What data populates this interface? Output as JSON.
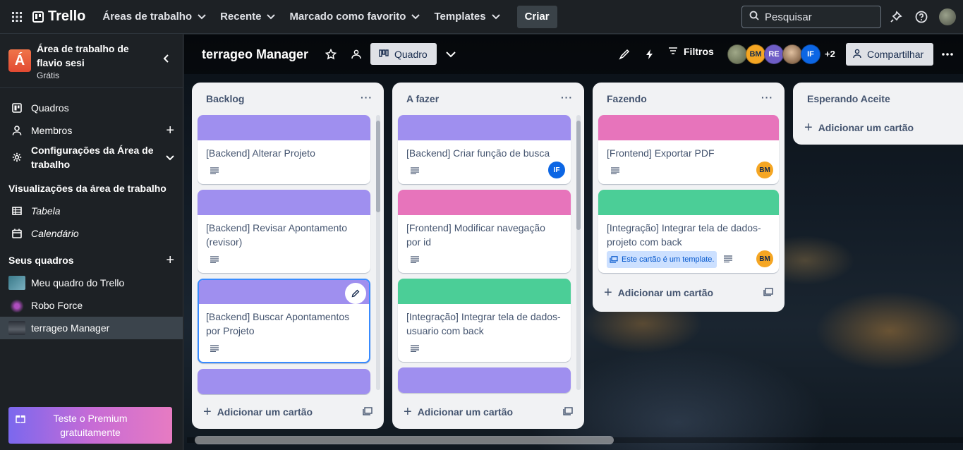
{
  "topbar": {
    "app_name": "Trello",
    "nav": [
      {
        "label": "Áreas de trabalho"
      },
      {
        "label": "Recente"
      },
      {
        "label": "Marcado como favorito"
      },
      {
        "label": "Templates"
      }
    ],
    "create_label": "Criar",
    "search_placeholder": "Pesquisar"
  },
  "sidebar": {
    "workspace_initial": "Á",
    "workspace_name_line1": "Área de trabalho de",
    "workspace_name_line2": "flavio sesi",
    "workspace_plan": "Grátis",
    "items": [
      {
        "label": "Quadros",
        "icon": "board-icon"
      },
      {
        "label": "Membros",
        "icon": "person-icon"
      },
      {
        "label_line1": "Configurações da Área de",
        "label_line2": "trabalho",
        "icon": "gear-icon"
      }
    ],
    "views_heading": "Visualizações da área de trabalho",
    "views": [
      {
        "label": "Tabela",
        "icon": "table-icon"
      },
      {
        "label": "Calendário",
        "icon": "calendar-icon"
      }
    ],
    "boards_heading": "Seus quadros",
    "boards": [
      {
        "label": "Meu quadro do Trello",
        "thumb_color": "#4a8a9a"
      },
      {
        "label": "Robo Force",
        "thumb_color": "#2a1a3a"
      },
      {
        "label": "terrageo Manager",
        "thumb_color": "#3a4048"
      }
    ],
    "premium_line1": "Teste o Premium",
    "premium_line2": "gratuitamente"
  },
  "board": {
    "title": "terrageo Manager",
    "view_label": "Quadro",
    "filters_label": "Filtros",
    "members": [
      {
        "initials": "",
        "color": "#7d8a6a"
      },
      {
        "initials": "BM",
        "color": "#f5a623"
      },
      {
        "initials": "RE",
        "color": "#6e5dc6"
      },
      {
        "initials": "",
        "color": "#a58a6a"
      },
      {
        "initials": "IF",
        "color": "#0c66e4"
      }
    ],
    "more_members": "+2",
    "share_label": "Compartilhar",
    "add_card_label": "Adicionar um cartão",
    "template_tag": "Este cartão é um template.",
    "lists": [
      {
        "title": "Backlog",
        "cards": [
          {
            "title_l1": "[Backend] Alterar Projeto",
            "cover": "#9f8fef"
          },
          {
            "title_l1": "[Backend] Revisar Apontamento",
            "title_l2": "(revisor)",
            "cover": "#9f8fef"
          },
          {
            "title_l1": "[Backend] Buscar Apontamentos",
            "title_l2": "por Projeto",
            "cover": "#9f8fef"
          }
        ]
      },
      {
        "title": "A fazer",
        "cards": [
          {
            "title_l1": "[Backend] Criar função de busca",
            "cover": "#9f8fef",
            "member": "IF",
            "member_color": "#0c66e4"
          },
          {
            "title_l1": "[Frontend] Modificar navegação",
            "title_l2": "por id",
            "cover": "#e774bb"
          },
          {
            "title_l1": "[Integração] Integrar tela de dados-",
            "title_l2": "usuario com back",
            "cover": "#4bce97"
          }
        ]
      },
      {
        "title": "Fazendo",
        "cards": [
          {
            "title_l1": "[Frontend] Exportar PDF",
            "cover": "#e774bb",
            "member": "BM",
            "member_color": "#f5a623"
          },
          {
            "title_l1": "[Integração] Integrar tela de dados-",
            "title_l2": "projeto com back",
            "cover": "#4bce97",
            "member": "BM",
            "member_color": "#f5a623"
          }
        ]
      },
      {
        "title": "Esperando Aceite",
        "cards": []
      }
    ]
  }
}
